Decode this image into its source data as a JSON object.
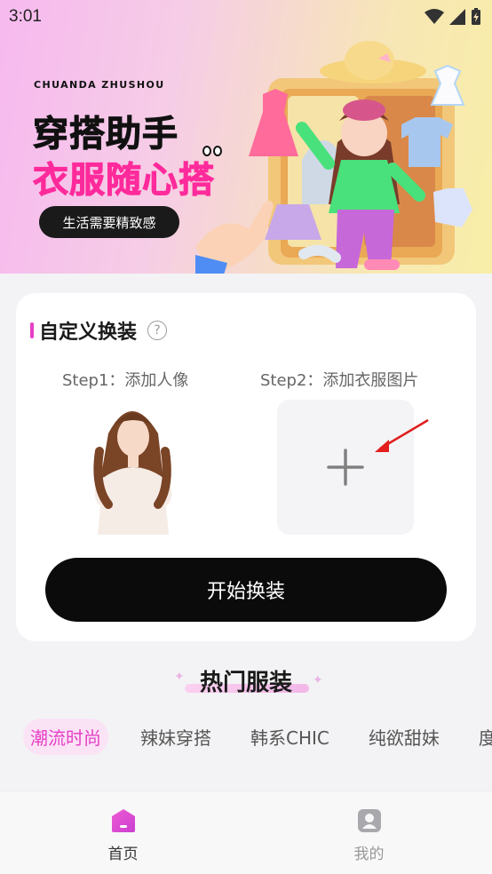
{
  "status_bar": {
    "time": "3:01"
  },
  "banner": {
    "brand_en": "CHUANDA ZHUSHOU",
    "title": "穿搭助手",
    "subtitle": "衣服随心搭",
    "tagline": "生活需要精致感"
  },
  "custom_card": {
    "title": "自定义换装",
    "help_icon_glyph": "?",
    "step1_label": "Step1：添加人像",
    "step2_label": "Step2：添加衣服图片",
    "start_button": "开始换装"
  },
  "hot_section": {
    "title": "热门服装",
    "categories": [
      "潮流时尚",
      "辣妹穿搭",
      "韩系CHIC",
      "纯欲甜妹",
      "度"
    ],
    "active_index": 0
  },
  "bottom_nav": {
    "items": [
      {
        "label": "首页",
        "icon": "home-icon",
        "active": true
      },
      {
        "label": "我的",
        "icon": "profile-icon",
        "active": false
      }
    ]
  },
  "colors": {
    "accent": "#e640c7",
    "pink_text": "#ff2a9b",
    "button_bg": "#0b0b0b"
  }
}
